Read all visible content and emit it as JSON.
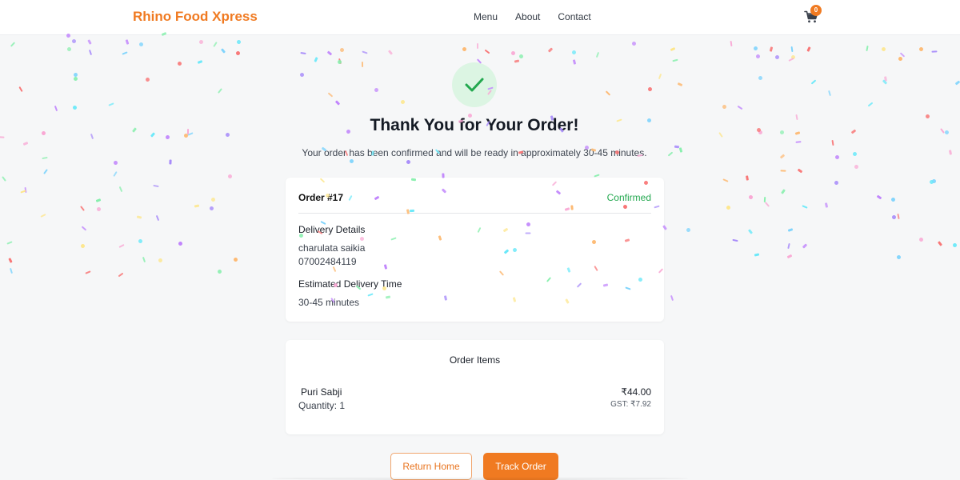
{
  "header": {
    "brand": "Rhino Food Xpress",
    "nav": [
      "Menu",
      "About",
      "Contact"
    ],
    "cart_count": "0",
    "cart_icon": "shopping-cart-icon"
  },
  "hero": {
    "icon": "check-icon",
    "title": "Thank You for Your Order!",
    "subtitle": "Your order has been confirmed and will be ready in approximately 30-45 minutes."
  },
  "order": {
    "number": "Order #17",
    "status": "Confirmed",
    "delivery_label": "Delivery Details",
    "customer_name": "charulata saikia",
    "phone": "07002484119",
    "eta_label": "Estimated Delivery Time",
    "eta_value": "30-45 minutes"
  },
  "items": {
    "title": "Order Items",
    "list": [
      {
        "name": "Puri Sabji",
        "quantity": "Quantity: 1",
        "price": "₹44.00",
        "gst": "GST: ₹7.92"
      }
    ]
  },
  "actions": {
    "return_home": "Return Home",
    "track_order": "Track Order"
  },
  "colors": {
    "accent": "#f07a21",
    "success": "#23a84f",
    "success_bg": "#dcf5e3",
    "confetti": [
      "#f9a8d4",
      "#c084fc",
      "#86efac",
      "#7dd3fc",
      "#fdba74",
      "#fde68a",
      "#f87171",
      "#a78bfa",
      "#67e8f9"
    ]
  }
}
